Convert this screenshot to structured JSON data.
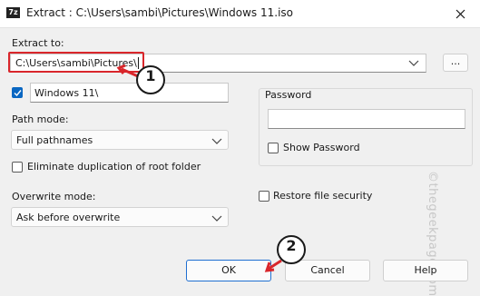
{
  "window": {
    "title": "Extract : C:\\Users\\sambi\\Pictures\\Windows 11.iso",
    "app_icon_text": "7z"
  },
  "extract_to": {
    "label": "Extract to:",
    "value": "C:\\Users\\sambi\\Pictures\\",
    "browse_label": "..."
  },
  "folder_name": {
    "checked": true,
    "value": "Windows 11\\"
  },
  "path_mode": {
    "label": "Path mode:",
    "value": "Full pathnames"
  },
  "eliminate_duplication": {
    "label": "Eliminate duplication of root folder",
    "checked": false
  },
  "overwrite_mode": {
    "label": "Overwrite mode:",
    "value": "Ask before overwrite"
  },
  "password": {
    "group_label": "Password",
    "value": "",
    "show_password_label": "Show Password",
    "show_password_checked": false
  },
  "restore_security": {
    "label": "Restore file security",
    "checked": false
  },
  "buttons": {
    "ok": "OK",
    "cancel": "Cancel",
    "help": "Help"
  },
  "annotations": {
    "step1": "1",
    "step2": "2",
    "highlight_color": "#d9262b"
  },
  "watermark": "©thegeekpage.com",
  "colors": {
    "accent": "#0a67c2",
    "arrow": "#d9262b"
  }
}
